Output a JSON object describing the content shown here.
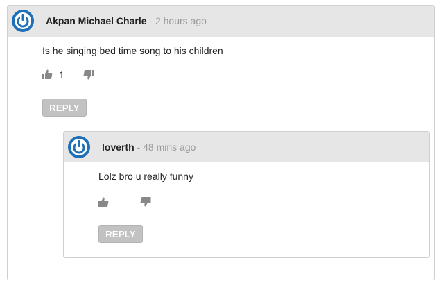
{
  "comments": [
    {
      "author": "Akpan Michael Charle",
      "time": " - 2 hours ago",
      "text": "Is he singing bed time song to his children",
      "likes": "1",
      "reply_label": "REPLY"
    },
    {
      "author": "loverth",
      "time": " - 48 mins ago",
      "text": "Lolz bro u really funny",
      "likes": "",
      "reply_label": "REPLY"
    }
  ],
  "colors": {
    "avatar": "#1f6fb8",
    "header_bg": "#e6e6e6",
    "button_bg": "#c2c2c2"
  },
  "icons": {
    "avatar": "power-avatar-icon",
    "like": "thumbs-up-icon",
    "dislike": "thumbs-down-icon"
  }
}
